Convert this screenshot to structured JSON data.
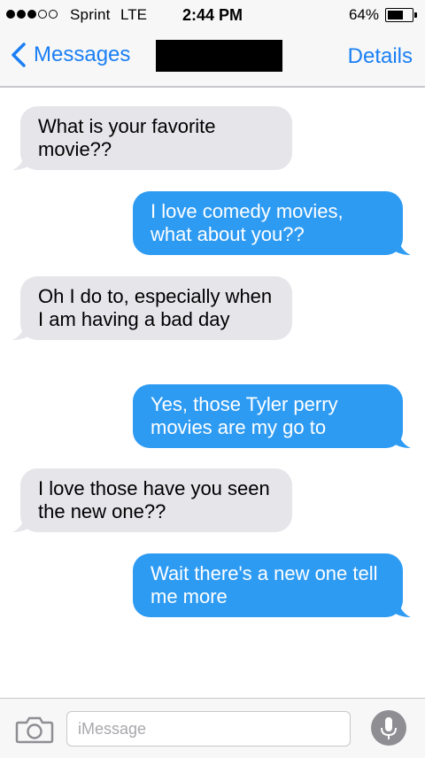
{
  "status_bar": {
    "carrier": "Sprint",
    "network": "LTE",
    "time": "2:44 PM",
    "battery_percent": "64%",
    "battery_level": 0.64,
    "signal_bars_filled": 3,
    "signal_bars_total": 5
  },
  "nav": {
    "back_label": "Messages",
    "contact_name": "[redacted]",
    "details_label": "Details"
  },
  "messages": [
    {
      "direction": "received",
      "text": "What is your favorite movie??"
    },
    {
      "direction": "sent",
      "text": "I love comedy movies, what about you??"
    },
    {
      "direction": "received",
      "text": "Oh I do to, especially when I am having a bad day"
    },
    {
      "direction": "sent",
      "text": "Yes, those Tyler perry movies are my go to"
    },
    {
      "direction": "received",
      "text": "I love those have you seen the new one??"
    },
    {
      "direction": "sent",
      "text": "Wait there's a new one tell me more"
    }
  ],
  "input": {
    "placeholder": "iMessage",
    "value": ""
  },
  "icons": {
    "back": "chevron-left-icon",
    "camera": "camera-icon",
    "mic": "microphone-icon"
  },
  "colors": {
    "accent": "#1a7ff5",
    "sent_bubble": "#2e9bf3",
    "received_bubble": "#e5e5ea"
  }
}
